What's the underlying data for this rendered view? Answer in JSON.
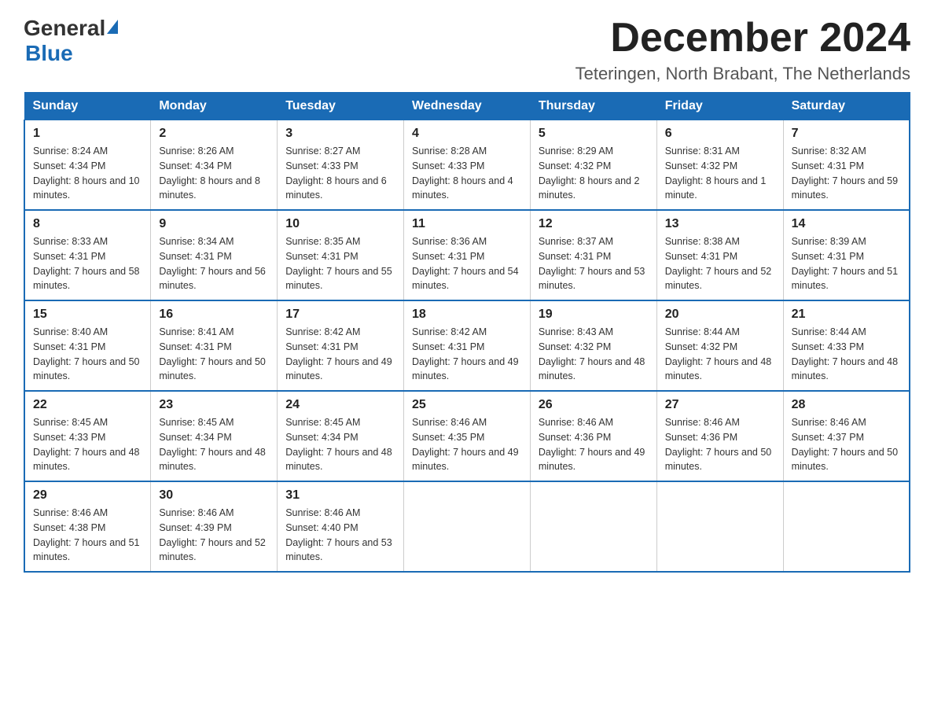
{
  "logo": {
    "general": "General",
    "blue": "Blue"
  },
  "title": {
    "month_year": "December 2024",
    "location": "Teteringen, North Brabant, The Netherlands"
  },
  "days_of_week": [
    "Sunday",
    "Monday",
    "Tuesday",
    "Wednesday",
    "Thursday",
    "Friday",
    "Saturday"
  ],
  "weeks": [
    [
      {
        "day": "1",
        "sunrise": "8:24 AM",
        "sunset": "4:34 PM",
        "daylight": "8 hours and 10 minutes."
      },
      {
        "day": "2",
        "sunrise": "8:26 AM",
        "sunset": "4:34 PM",
        "daylight": "8 hours and 8 minutes."
      },
      {
        "day": "3",
        "sunrise": "8:27 AM",
        "sunset": "4:33 PM",
        "daylight": "8 hours and 6 minutes."
      },
      {
        "day": "4",
        "sunrise": "8:28 AM",
        "sunset": "4:33 PM",
        "daylight": "8 hours and 4 minutes."
      },
      {
        "day": "5",
        "sunrise": "8:29 AM",
        "sunset": "4:32 PM",
        "daylight": "8 hours and 2 minutes."
      },
      {
        "day": "6",
        "sunrise": "8:31 AM",
        "sunset": "4:32 PM",
        "daylight": "8 hours and 1 minute."
      },
      {
        "day": "7",
        "sunrise": "8:32 AM",
        "sunset": "4:31 PM",
        "daylight": "7 hours and 59 minutes."
      }
    ],
    [
      {
        "day": "8",
        "sunrise": "8:33 AM",
        "sunset": "4:31 PM",
        "daylight": "7 hours and 58 minutes."
      },
      {
        "day": "9",
        "sunrise": "8:34 AM",
        "sunset": "4:31 PM",
        "daylight": "7 hours and 56 minutes."
      },
      {
        "day": "10",
        "sunrise": "8:35 AM",
        "sunset": "4:31 PM",
        "daylight": "7 hours and 55 minutes."
      },
      {
        "day": "11",
        "sunrise": "8:36 AM",
        "sunset": "4:31 PM",
        "daylight": "7 hours and 54 minutes."
      },
      {
        "day": "12",
        "sunrise": "8:37 AM",
        "sunset": "4:31 PM",
        "daylight": "7 hours and 53 minutes."
      },
      {
        "day": "13",
        "sunrise": "8:38 AM",
        "sunset": "4:31 PM",
        "daylight": "7 hours and 52 minutes."
      },
      {
        "day": "14",
        "sunrise": "8:39 AM",
        "sunset": "4:31 PM",
        "daylight": "7 hours and 51 minutes."
      }
    ],
    [
      {
        "day": "15",
        "sunrise": "8:40 AM",
        "sunset": "4:31 PM",
        "daylight": "7 hours and 50 minutes."
      },
      {
        "day": "16",
        "sunrise": "8:41 AM",
        "sunset": "4:31 PM",
        "daylight": "7 hours and 50 minutes."
      },
      {
        "day": "17",
        "sunrise": "8:42 AM",
        "sunset": "4:31 PM",
        "daylight": "7 hours and 49 minutes."
      },
      {
        "day": "18",
        "sunrise": "8:42 AM",
        "sunset": "4:31 PM",
        "daylight": "7 hours and 49 minutes."
      },
      {
        "day": "19",
        "sunrise": "8:43 AM",
        "sunset": "4:32 PM",
        "daylight": "7 hours and 48 minutes."
      },
      {
        "day": "20",
        "sunrise": "8:44 AM",
        "sunset": "4:32 PM",
        "daylight": "7 hours and 48 minutes."
      },
      {
        "day": "21",
        "sunrise": "8:44 AM",
        "sunset": "4:33 PM",
        "daylight": "7 hours and 48 minutes."
      }
    ],
    [
      {
        "day": "22",
        "sunrise": "8:45 AM",
        "sunset": "4:33 PM",
        "daylight": "7 hours and 48 minutes."
      },
      {
        "day": "23",
        "sunrise": "8:45 AM",
        "sunset": "4:34 PM",
        "daylight": "7 hours and 48 minutes."
      },
      {
        "day": "24",
        "sunrise": "8:45 AM",
        "sunset": "4:34 PM",
        "daylight": "7 hours and 48 minutes."
      },
      {
        "day": "25",
        "sunrise": "8:46 AM",
        "sunset": "4:35 PM",
        "daylight": "7 hours and 49 minutes."
      },
      {
        "day": "26",
        "sunrise": "8:46 AM",
        "sunset": "4:36 PM",
        "daylight": "7 hours and 49 minutes."
      },
      {
        "day": "27",
        "sunrise": "8:46 AM",
        "sunset": "4:36 PM",
        "daylight": "7 hours and 50 minutes."
      },
      {
        "day": "28",
        "sunrise": "8:46 AM",
        "sunset": "4:37 PM",
        "daylight": "7 hours and 50 minutes."
      }
    ],
    [
      {
        "day": "29",
        "sunrise": "8:46 AM",
        "sunset": "4:38 PM",
        "daylight": "7 hours and 51 minutes."
      },
      {
        "day": "30",
        "sunrise": "8:46 AM",
        "sunset": "4:39 PM",
        "daylight": "7 hours and 52 minutes."
      },
      {
        "day": "31",
        "sunrise": "8:46 AM",
        "sunset": "4:40 PM",
        "daylight": "7 hours and 53 minutes."
      },
      {
        "day": "",
        "sunrise": "",
        "sunset": "",
        "daylight": ""
      },
      {
        "day": "",
        "sunrise": "",
        "sunset": "",
        "daylight": ""
      },
      {
        "day": "",
        "sunrise": "",
        "sunset": "",
        "daylight": ""
      },
      {
        "day": "",
        "sunrise": "",
        "sunset": "",
        "daylight": ""
      }
    ]
  ]
}
